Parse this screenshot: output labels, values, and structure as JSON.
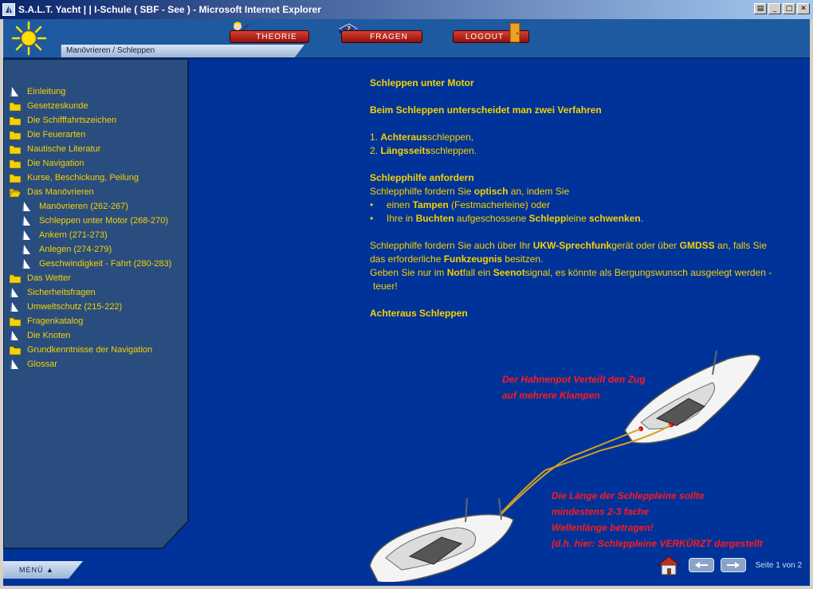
{
  "window": {
    "title": "S.A.L.T. Yacht | | I-Schule ( SBF - See ) - Microsoft Internet Explorer"
  },
  "header": {
    "breadcrumb": "Manövrieren / Schleppen",
    "buttons": {
      "theorie": "THEORIE",
      "fragen": "FRAGEN",
      "logout": "LOGOUT"
    }
  },
  "sidebar": {
    "items": [
      {
        "label": "Einleitung",
        "icon": "document-icon",
        "sub": false
      },
      {
        "label": "Gesetzeskunde",
        "icon": "folder-icon",
        "sub": false
      },
      {
        "label": "Die Schifffahrtszeichen",
        "icon": "folder-icon",
        "sub": false
      },
      {
        "label": "Die Feuerarten",
        "icon": "folder-icon",
        "sub": false
      },
      {
        "label": "Nautische Literatur",
        "icon": "folder-icon",
        "sub": false
      },
      {
        "label": "Die Navigation",
        "icon": "folder-icon",
        "sub": false
      },
      {
        "label": "Kurse, Beschickung, Peilung",
        "icon": "folder-icon",
        "sub": false
      },
      {
        "label": "Das Manövrieren",
        "icon": "folder-open-icon",
        "sub": false
      },
      {
        "label": "Manövrieren (262-267)",
        "icon": "document-icon",
        "sub": true
      },
      {
        "label": "Schleppen unter Motor (268-270)",
        "icon": "document-icon",
        "sub": true
      },
      {
        "label": "Ankern (271-273)",
        "icon": "document-icon",
        "sub": true
      },
      {
        "label": "Anlegen (274-279)",
        "icon": "document-icon",
        "sub": true
      },
      {
        "label": "Geschwindigkeit - Fahrt (280-283)",
        "icon": "document-icon",
        "sub": true
      },
      {
        "label": "Das Wetter",
        "icon": "folder-icon",
        "sub": false
      },
      {
        "label": "Sicherheitsfragen",
        "icon": "document-icon",
        "sub": false
      },
      {
        "label": "Umweltschutz (215-222)",
        "icon": "document-icon",
        "sub": false
      },
      {
        "label": "Fragenkatalog",
        "icon": "folder-icon",
        "sub": false
      },
      {
        "label": "Die Knoten",
        "icon": "document-icon",
        "sub": false
      },
      {
        "label": "Grundkenntnisse der Navigation",
        "icon": "folder-icon",
        "sub": false
      },
      {
        "label": "Glossar",
        "icon": "document-icon",
        "sub": false
      }
    ],
    "menu_label": "MENÜ ▲"
  },
  "content": {
    "title": "Schleppen unter Motor",
    "intro": "Beim Schleppen unterscheidet man zwei Verfahren",
    "list": [
      {
        "num": "1.",
        "bold": "Achteraus",
        "rest": "schleppen,"
      },
      {
        "num": "2.",
        "bold": "Längsseits",
        "rest": "schleppen."
      }
    ],
    "section1_title": "Schlepphilfe anfordern",
    "p1": {
      "a": "Schlepphilfe fordern Sie ",
      "b": "optisch",
      "c": " an, indem Sie"
    },
    "bullet1": {
      "a": "einen ",
      "b": "Tampen",
      "c": " (Festmacherleine) oder"
    },
    "bullet2": {
      "a": "Ihre in ",
      "b": "Buchten",
      "c": " aufgeschossene ",
      "d": "Schlepp",
      "e": "leine ",
      "f": "schwenken",
      "g": "."
    },
    "p2_line1": {
      "a": "Schlepphilfe fordern Sie auch über Ihr ",
      "b": "UKW-Sprechfunk",
      "c": "gerät oder über ",
      "d": "GMDSS",
      "e": " an, falls Sie"
    },
    "p2_line2": {
      "a": "das erforderliche ",
      "b": "Funkzeugnis",
      "c": " besitzen."
    },
    "p2_line3": {
      "a": "Geben Sie nur im ",
      "b": "Not",
      "c": "fall ein ",
      "d": "Seenot",
      "e": "signal, es könnte als Bergungswunsch ausgelegt werden  -"
    },
    "p2_line4": "teuer!",
    "section2_title": "Achteraus Schleppen",
    "note1": [
      "Der Hahnenpot Verteilt den Zug",
      "auf mehrere Klampen"
    ],
    "note2": [
      "Die Länge der Schleppleine sollte",
      "mindestens 2-3 fache",
      "Wellenlänge betragen!",
      "(d.h. hier: Schleppleine VERKÜRZT dargestellt"
    ],
    "page_info": "Seite 1 von 2"
  },
  "colors": {
    "text": "#f4d200",
    "background": "#003399",
    "sidebar": "#2a4d7f",
    "note": "#ff1a1a"
  }
}
